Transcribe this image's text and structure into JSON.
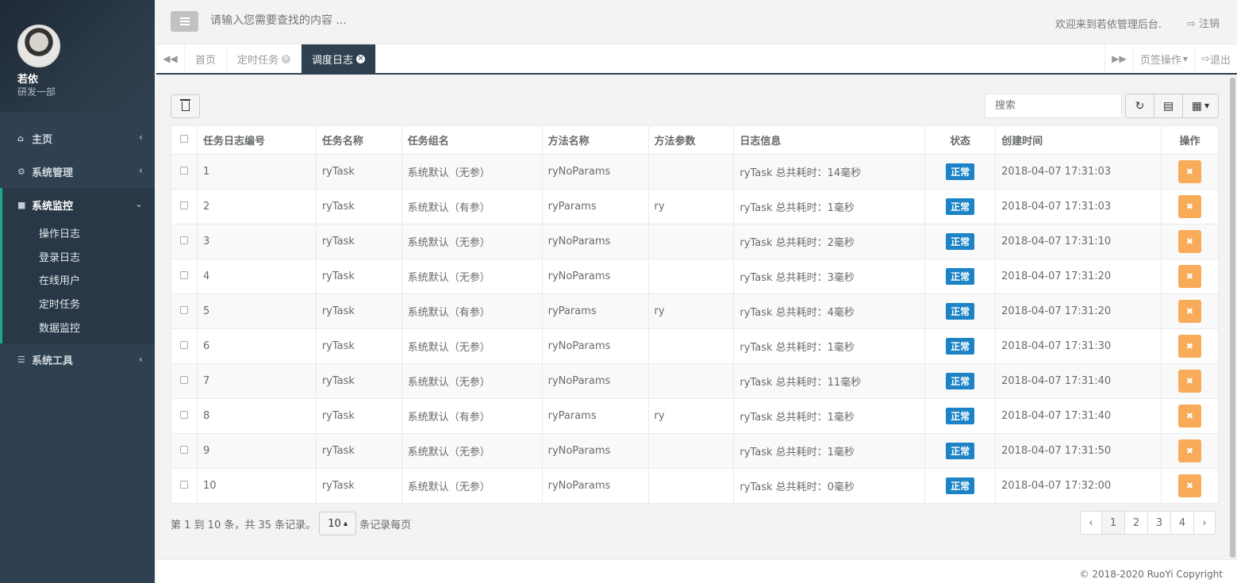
{
  "sidebar": {
    "user_name": "若依",
    "user_dept": "研发一部",
    "menu": [
      {
        "label": "主页",
        "icon": "home-icon"
      },
      {
        "label": "系统管理",
        "icon": "gear-icon"
      },
      {
        "label": "系统监控",
        "icon": "video-camera-icon"
      },
      {
        "label": "系统工具",
        "icon": "bars-icon"
      }
    ],
    "submenu": [
      "操作日志",
      "登录日志",
      "在线用户",
      "定时任务",
      "数据监控"
    ]
  },
  "topbar": {
    "search_placeholder": "请输入您需要查找的内容 ...",
    "welcome": "欢迎来到若依管理后台.",
    "logout": "注销"
  },
  "tabs": [
    {
      "label": "首页"
    },
    {
      "label": "定时任务"
    },
    {
      "label": "调度日志"
    }
  ],
  "tab_actions": {
    "page_ops": "页签操作",
    "exit": "退出"
  },
  "toolbar": {
    "search_placeholder": "搜索"
  },
  "table": {
    "headers": [
      "任务日志编号",
      "任务名称",
      "任务组名",
      "方法名称",
      "方法参数",
      "日志信息",
      "状态",
      "创建时间",
      "操作"
    ],
    "rows": [
      {
        "id": "1",
        "name": "ryTask",
        "group": "系统默认（无参）",
        "method": "ryNoParams",
        "params": "",
        "info": "ryTask 总共耗时：14毫秒",
        "status": "正常",
        "time": "2018-04-07 17:31:03"
      },
      {
        "id": "2",
        "name": "ryTask",
        "group": "系统默认（有参）",
        "method": "ryParams",
        "params": "ry",
        "info": "ryTask 总共耗时：1毫秒",
        "status": "正常",
        "time": "2018-04-07 17:31:03"
      },
      {
        "id": "3",
        "name": "ryTask",
        "group": "系统默认（无参）",
        "method": "ryNoParams",
        "params": "",
        "info": "ryTask 总共耗时：2毫秒",
        "status": "正常",
        "time": "2018-04-07 17:31:10"
      },
      {
        "id": "4",
        "name": "ryTask",
        "group": "系统默认（无参）",
        "method": "ryNoParams",
        "params": "",
        "info": "ryTask 总共耗时：3毫秒",
        "status": "正常",
        "time": "2018-04-07 17:31:20"
      },
      {
        "id": "5",
        "name": "ryTask",
        "group": "系统默认（有参）",
        "method": "ryParams",
        "params": "ry",
        "info": "ryTask 总共耗时：4毫秒",
        "status": "正常",
        "time": "2018-04-07 17:31:20"
      },
      {
        "id": "6",
        "name": "ryTask",
        "group": "系统默认（无参）",
        "method": "ryNoParams",
        "params": "",
        "info": "ryTask 总共耗时：1毫秒",
        "status": "正常",
        "time": "2018-04-07 17:31:30"
      },
      {
        "id": "7",
        "name": "ryTask",
        "group": "系统默认（无参）",
        "method": "ryNoParams",
        "params": "",
        "info": "ryTask 总共耗时：11毫秒",
        "status": "正常",
        "time": "2018-04-07 17:31:40"
      },
      {
        "id": "8",
        "name": "ryTask",
        "group": "系统默认（有参）",
        "method": "ryParams",
        "params": "ry",
        "info": "ryTask 总共耗时：1毫秒",
        "status": "正常",
        "time": "2018-04-07 17:31:40"
      },
      {
        "id": "9",
        "name": "ryTask",
        "group": "系统默认（无参）",
        "method": "ryNoParams",
        "params": "",
        "info": "ryTask 总共耗时：1毫秒",
        "status": "正常",
        "time": "2018-04-07 17:31:50"
      },
      {
        "id": "10",
        "name": "ryTask",
        "group": "系统默认（无参）",
        "method": "ryNoParams",
        "params": "",
        "info": "ryTask 总共耗时：0毫秒",
        "status": "正常",
        "time": "2018-04-07 17:32:00"
      }
    ]
  },
  "pagination": {
    "info_prefix": "第 1 到 10 条，共 35 条记录。",
    "page_size": "10",
    "info_suffix": "条记录每页",
    "prev": "‹",
    "pages": [
      "1",
      "2",
      "3",
      "4"
    ],
    "next": "›"
  },
  "footer": {
    "copyright": "© 2018-2020 RuoYi Copyright"
  },
  "colors": {
    "sidebar_bg": "#2f4050",
    "accent_green": "#19aa8d",
    "status_blue": "#1c84c6",
    "delete_orange": "#f8ac59"
  }
}
